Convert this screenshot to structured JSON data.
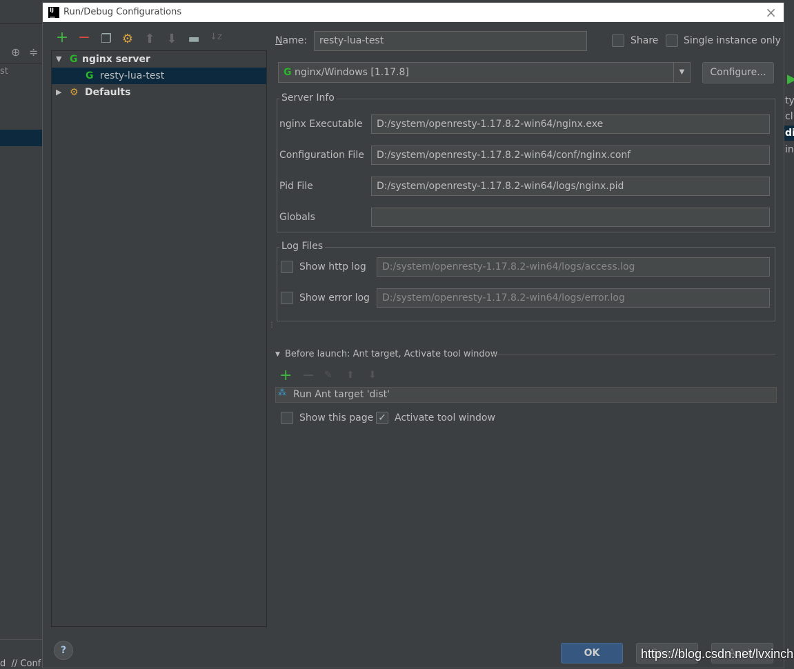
{
  "window": {
    "title": "Run/Debug Configurations",
    "logo": "IJ"
  },
  "toolbar": {
    "icons": [
      "add-icon",
      "remove-icon",
      "copy-icon",
      "edit-defaults-icon",
      "move-up-icon",
      "move-down-icon",
      "folder-icon",
      "sort-alpha-icon"
    ]
  },
  "tree": {
    "group": "nginx server",
    "item": "resty-lua-test",
    "defaults": "Defaults"
  },
  "form": {
    "name_label": "ame:",
    "name_value": "resty-lua-test",
    "share": "Share",
    "single_instance": "Single instance only",
    "server_select": "nginx/Windows [1.17.8]",
    "configure": "Configure...",
    "server_info": "Server Info",
    "fields": [
      {
        "label": "nginx Executable",
        "value": "D:/system/openresty-1.17.8.2-win64/nginx.exe"
      },
      {
        "label": "Configuration File",
        "value": "D:/system/openresty-1.17.8.2-win64/conf/nginx.conf"
      },
      {
        "label": "Pid File",
        "value": "D:/system/openresty-1.17.8.2-win64/logs/nginx.pid"
      },
      {
        "label": "Globals",
        "value": ""
      }
    ],
    "log_files": "Log Files",
    "http_log_label": "Show http log",
    "http_log_value": "D:/system/openresty-1.17.8.2-win64/logs/access.log",
    "error_log_label": "Show error log",
    "error_log_value": "D:/system/openresty-1.17.8.2-win64/logs/error.log",
    "before_launch": "Before launch: Ant target, Activate tool window",
    "task": "Run Ant target 'dist'",
    "show_page": "Show this page",
    "show_page_checked": false,
    "activate": "Activate tool window",
    "activate_checked": true
  },
  "footer": {
    "ok": "OK",
    "cancel": "Cancel",
    "apply": "Apply",
    "help": "?"
  },
  "watermark": "https://blog.csdn.net/lvxinchun",
  "background": {
    "left_text": "st",
    "bottom_text": "d  // Conf",
    "right_texts": [
      "ty-",
      "cl",
      "di",
      "in"
    ]
  },
  "colors": {
    "accent": "#365880",
    "selection": "#0d293e",
    "green": "#2bb52b"
  }
}
